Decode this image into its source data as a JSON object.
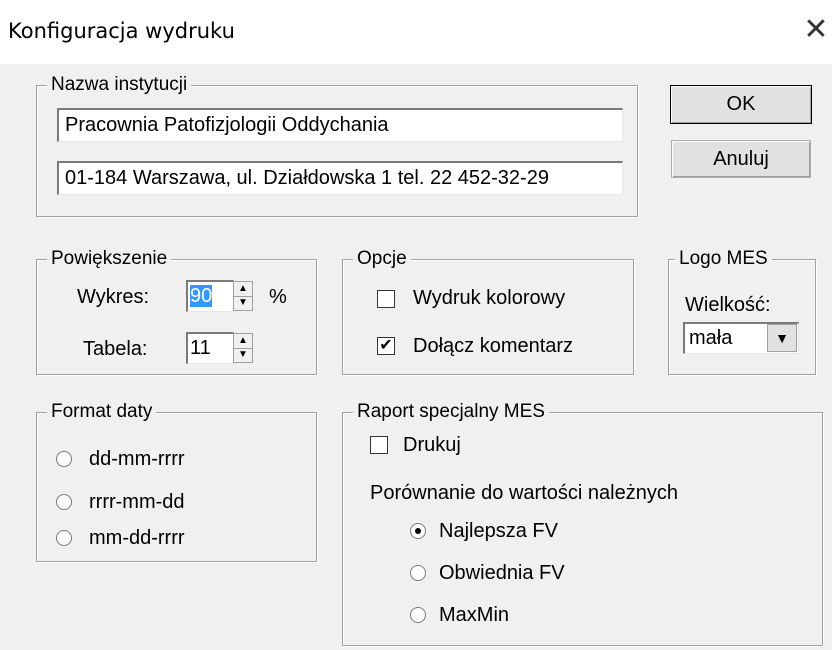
{
  "window": {
    "title": "Konfiguracja wydruku",
    "close_glyph": "✕"
  },
  "institution": {
    "legend": "Nazwa instytucji",
    "line1": "Pracownia Patofizjologii Oddychania",
    "line2": "01-184 Warszawa, ul. Działdowska 1 tel. 22 452-32-29"
  },
  "buttons": {
    "ok": "OK",
    "cancel": "Anuluj"
  },
  "zoom": {
    "legend": "Powiększenie",
    "chart_label": "Wykres:",
    "chart_value": "90",
    "chart_unit": "%",
    "table_label": "Tabela:",
    "table_value": "11"
  },
  "options": {
    "legend": "Opcje",
    "color_print": {
      "label": "Wydruk kolorowy",
      "checked": false
    },
    "attach_comment": {
      "label": "Dołącz komentarz",
      "checked": true
    }
  },
  "logo": {
    "legend": "Logo MES",
    "size_label": "Wielkość:",
    "size_value": "mała"
  },
  "date_format": {
    "legend": "Format daty",
    "options": [
      "dd-mm-rrrr",
      "rrrr-mm-dd",
      "mm-dd-rrrr"
    ],
    "selected": -1
  },
  "report": {
    "legend": "Raport specjalny MES",
    "print": {
      "label": "Drukuj",
      "checked": false
    },
    "compare_label": "Porównanie do wartości należnych",
    "options": [
      "Najlepsza FV",
      "Obwiednia FV",
      "MaxMin"
    ],
    "selected": 0
  },
  "icons": {
    "close": "close-icon",
    "spin_up": "spin-up-icon",
    "spin_down": "spin-down-icon",
    "dropdown": "chevron-down-icon",
    "check": "checkmark-icon"
  }
}
